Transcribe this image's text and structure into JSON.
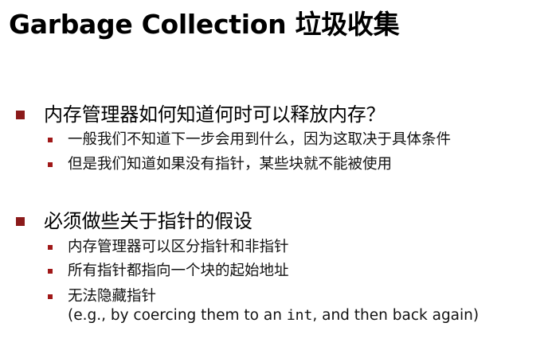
{
  "title": "Garbage Collection 垃圾收集",
  "sections": [
    {
      "heading": "内存管理器如何知道何时可以释放内存？",
      "items": [
        "一般我们不知道下一步会用到什么，因为这取决于具体条件",
        "但是我们知道如果没有指针，某些块就不能被使用"
      ]
    },
    {
      "heading": "必须做些关于指针的假设",
      "items": [
        "内存管理器可以区分指针和非指针",
        "所有指针都指向一个块的起始地址",
        "无法隐藏指针"
      ],
      "note": {
        "before": "(e.g., by coercing them to an ",
        "code": "int",
        "after": ", and then back again)"
      }
    }
  ],
  "colors": {
    "bullet": "#8b1a1a",
    "text": "#000000"
  }
}
